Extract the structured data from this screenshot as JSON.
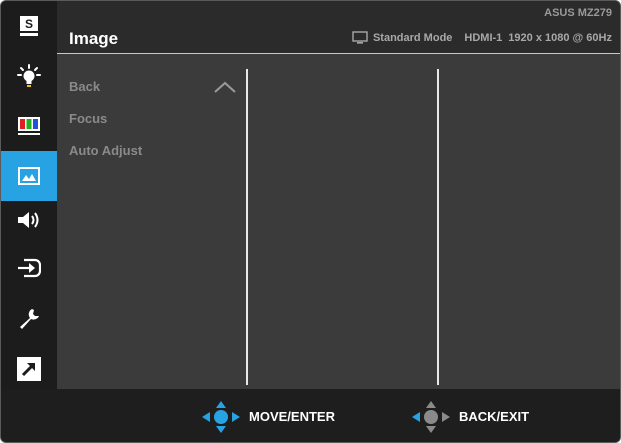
{
  "header": {
    "title": "Image",
    "model": "ASUS MZ279",
    "mode": "Standard Mode",
    "input": "HDMI-1",
    "resolution": "1920 x 1080 @ 60Hz"
  },
  "sidebar": {
    "selected_index": 3,
    "items": [
      {
        "icon": "splendid-icon",
        "label": "S"
      },
      {
        "icon": "blue-light-icon"
      },
      {
        "icon": "color-icon"
      },
      {
        "icon": "image-icon"
      },
      {
        "icon": "sound-icon"
      },
      {
        "icon": "input-select-icon"
      },
      {
        "icon": "system-setup-icon"
      },
      {
        "icon": "shortcut-icon"
      }
    ]
  },
  "menu": {
    "items": [
      "Back",
      "Focus",
      "Auto Adjust"
    ]
  },
  "footer": {
    "move_enter": "MOVE/ENTER",
    "back_exit": "BACK/EXIT"
  },
  "colors": {
    "accent": "#27a3e3",
    "background": "#3b3b3b",
    "sidebar": "#1c1c1c",
    "footer": "#1e1e1e"
  }
}
